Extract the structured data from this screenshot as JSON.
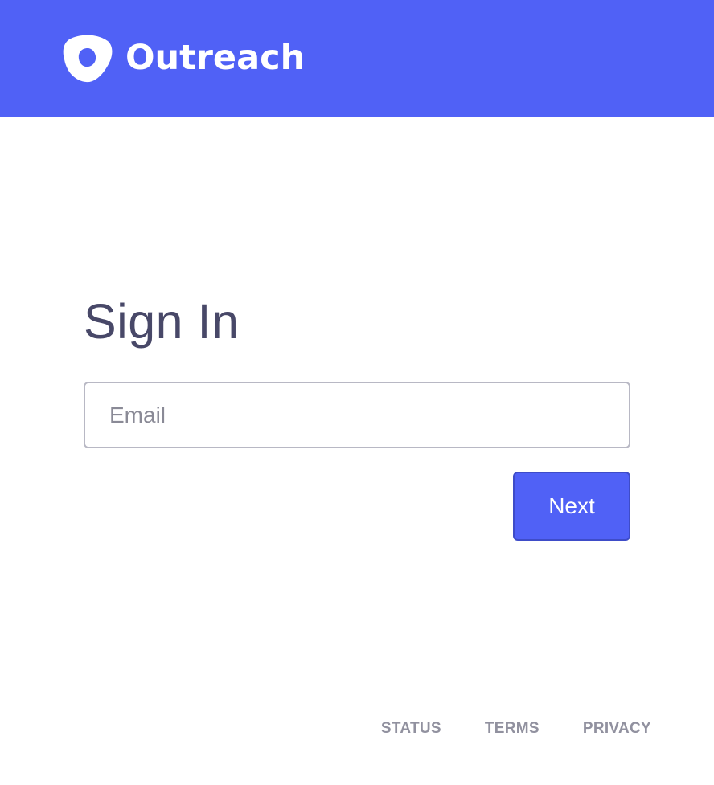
{
  "brand": {
    "name": "Outreach",
    "icon": "outreach-logo-icon",
    "color": "#5061f6"
  },
  "signin": {
    "title": "Sign In",
    "email_value": "",
    "email_placeholder": "Email",
    "next_label": "Next"
  },
  "footer": {
    "links": [
      {
        "label": "STATUS"
      },
      {
        "label": "TERMS"
      },
      {
        "label": "PRIVACY"
      }
    ]
  },
  "colors": {
    "header_bg": "#5061f6",
    "title_text": "#484868",
    "footer_text": "#91919f",
    "button_bg": "#5061f6"
  }
}
